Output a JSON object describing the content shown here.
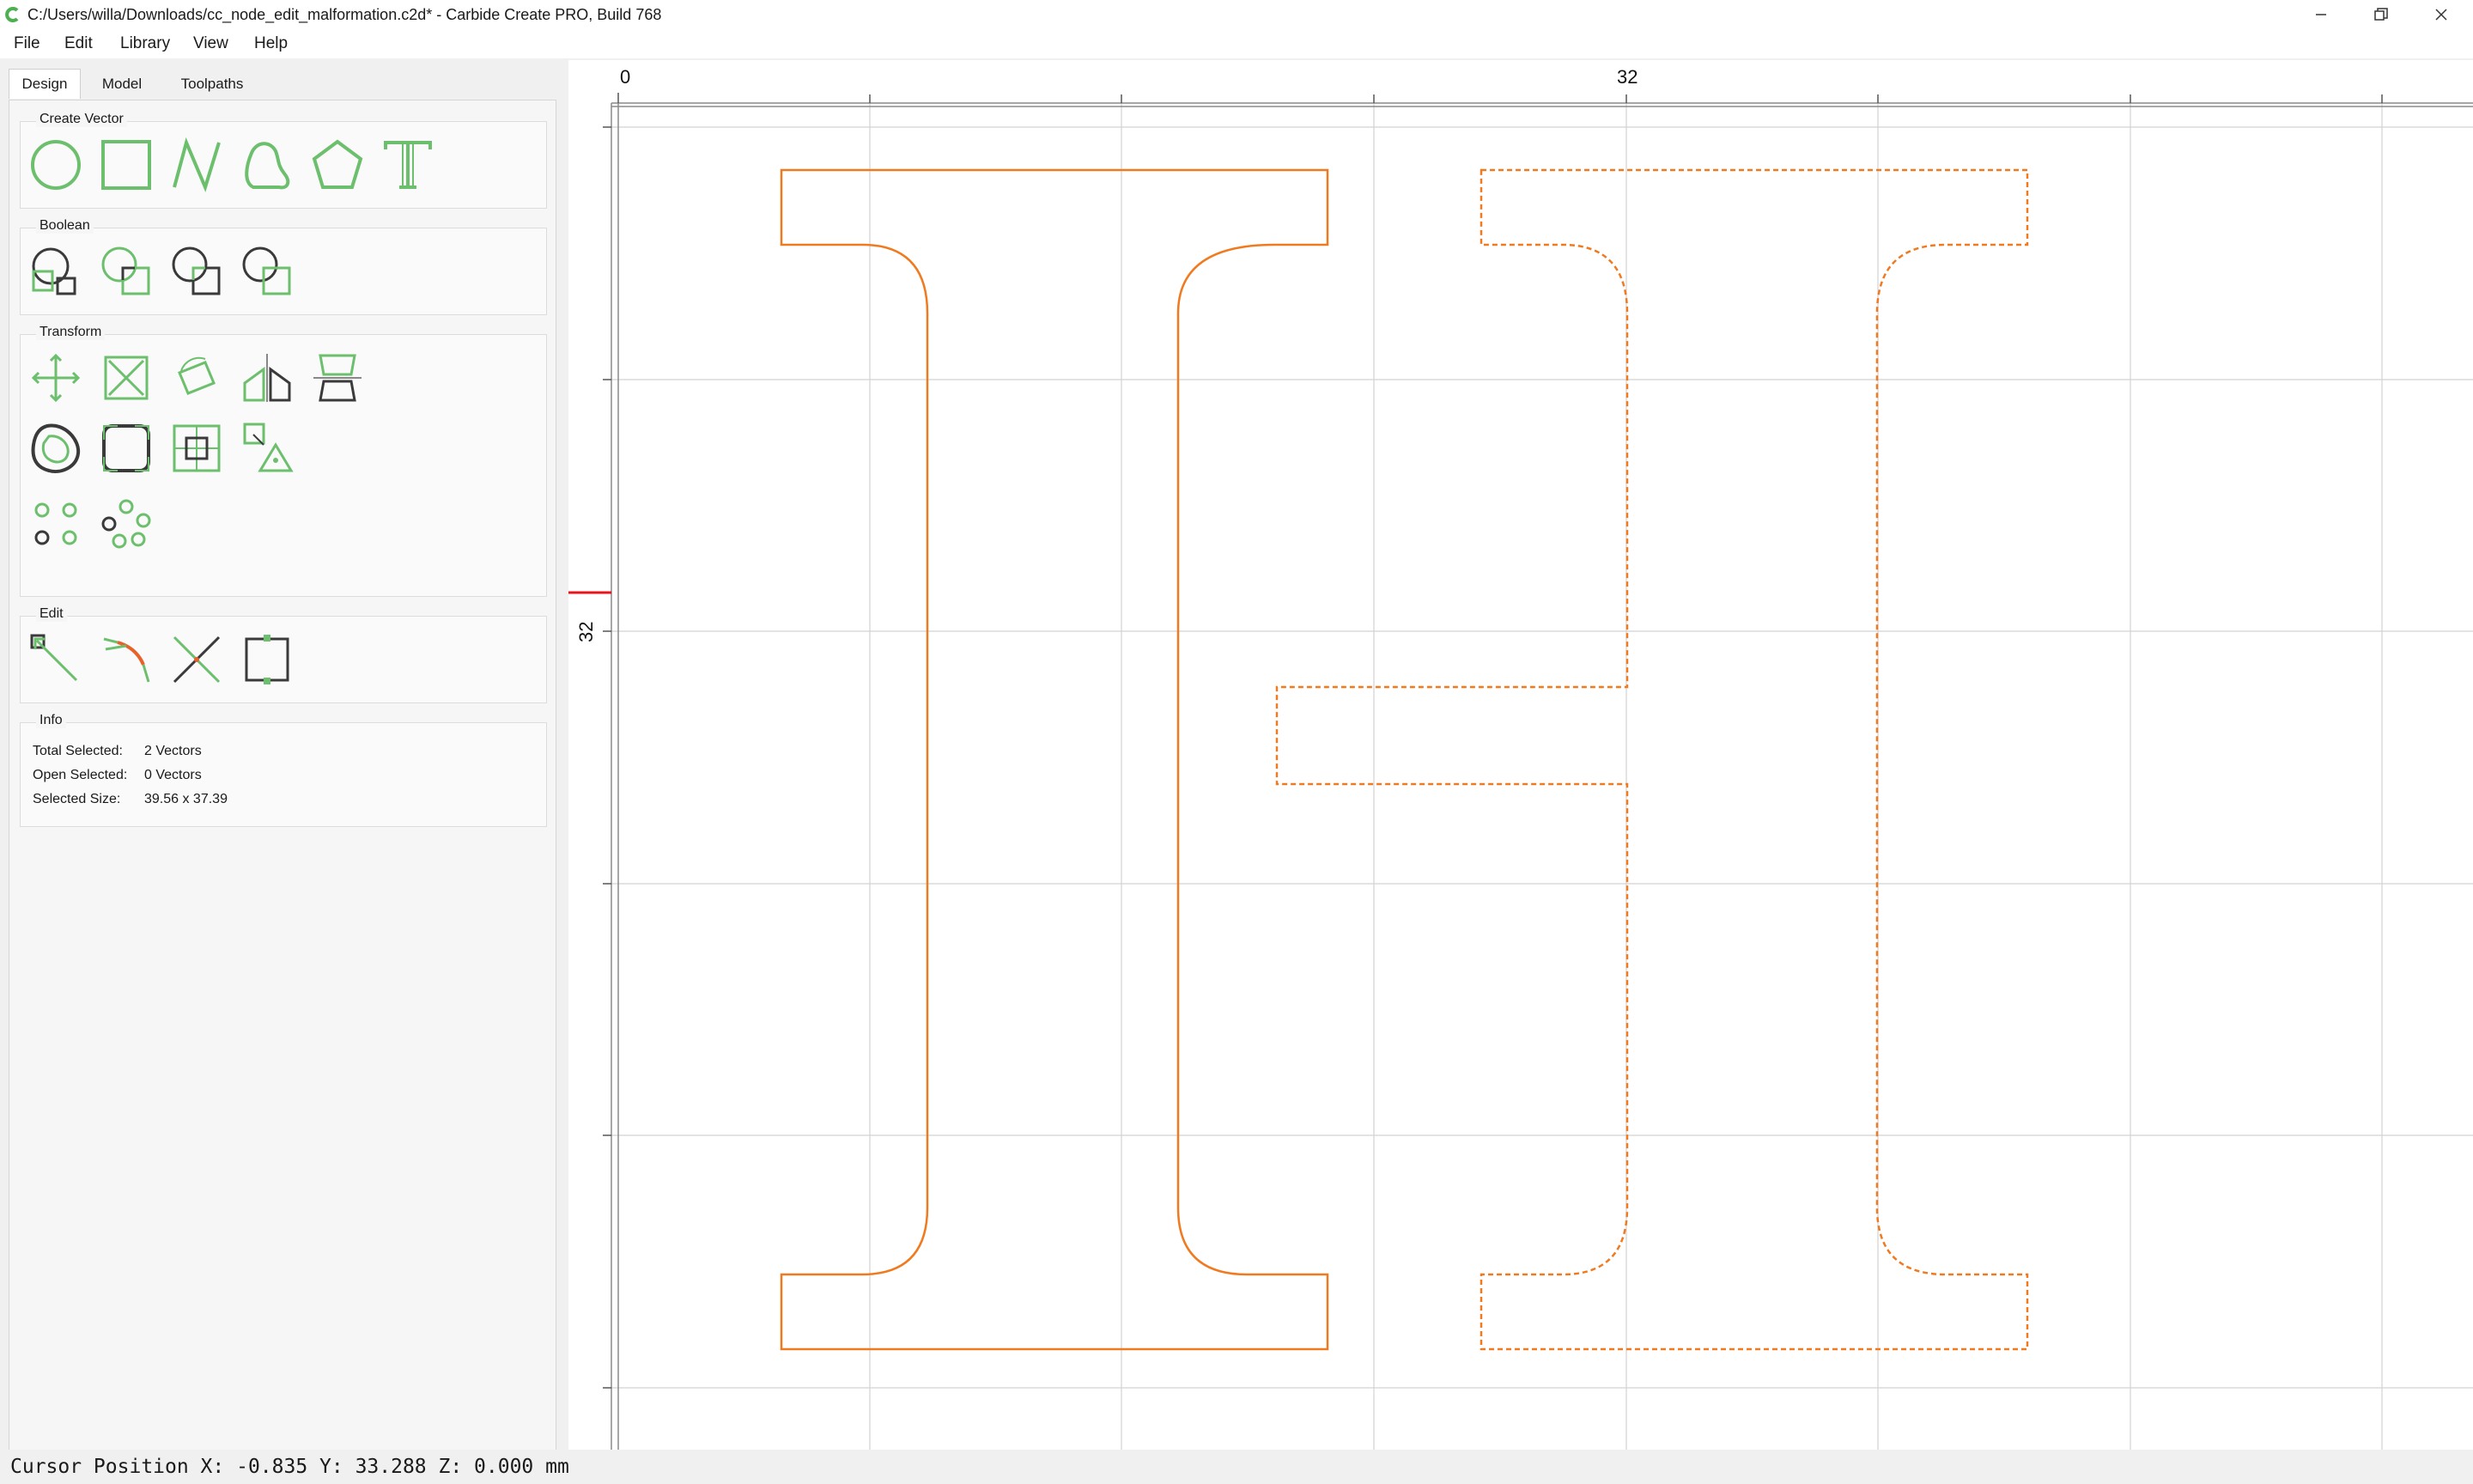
{
  "window": {
    "title": "C:/Users/willa/Downloads/cc_node_edit_malformation.c2d* - Carbide Create PRO, Build 768",
    "controls": [
      "minimize-icon",
      "restore-icon",
      "close-icon"
    ]
  },
  "menu": {
    "items": [
      "File",
      "Edit",
      "Library",
      "View",
      "Help"
    ]
  },
  "tabs": {
    "items": [
      "Design",
      "Model",
      "Toolpaths"
    ],
    "active": "Design"
  },
  "groups": {
    "create_vector": {
      "title": "Create Vector",
      "tools": [
        "circle-icon",
        "rectangle-icon",
        "polyline-icon",
        "curve-icon",
        "polygon-icon",
        "text-icon"
      ]
    },
    "boolean": {
      "title": "Boolean",
      "tools": [
        "union-icon",
        "subtract-icon",
        "intersect-icon",
        "weld-icon"
      ]
    },
    "transform": {
      "title": "Transform",
      "tools": [
        "move-icon",
        "scale-icon",
        "rotate-icon",
        "mirror-icon",
        "align-icon",
        "offset-icon",
        "fillet-icon",
        "join-icon",
        "nest-icon",
        "grid-array-icon",
        "circular-array-icon"
      ]
    },
    "edit": {
      "title": "Edit",
      "tools": [
        "node-edit-icon",
        "trim-icon",
        "cut-icon",
        "bounding-box-icon"
      ]
    },
    "info": {
      "title": "Info",
      "rows": [
        {
          "label": "Total Selected:",
          "value": "2 Vectors"
        },
        {
          "label": "Open Selected:",
          "value": "0 Vectors"
        },
        {
          "label": "Selected Size:",
          "value": "39.56 x 37.39"
        }
      ]
    }
  },
  "canvas": {
    "ruler_top_labels": [
      "0",
      "32"
    ],
    "ruler_left_labels": [
      "32"
    ],
    "colors": {
      "vector": "#f07a20",
      "grid": "#cfcfcf",
      "cursor_marker": "#e8141c",
      "tool_green": "#6cbf6c",
      "tool_dark": "#3a3a3a"
    }
  },
  "status": {
    "text": "Cursor Position X: -0.835 Y: 33.288 Z: 0.000 mm"
  }
}
